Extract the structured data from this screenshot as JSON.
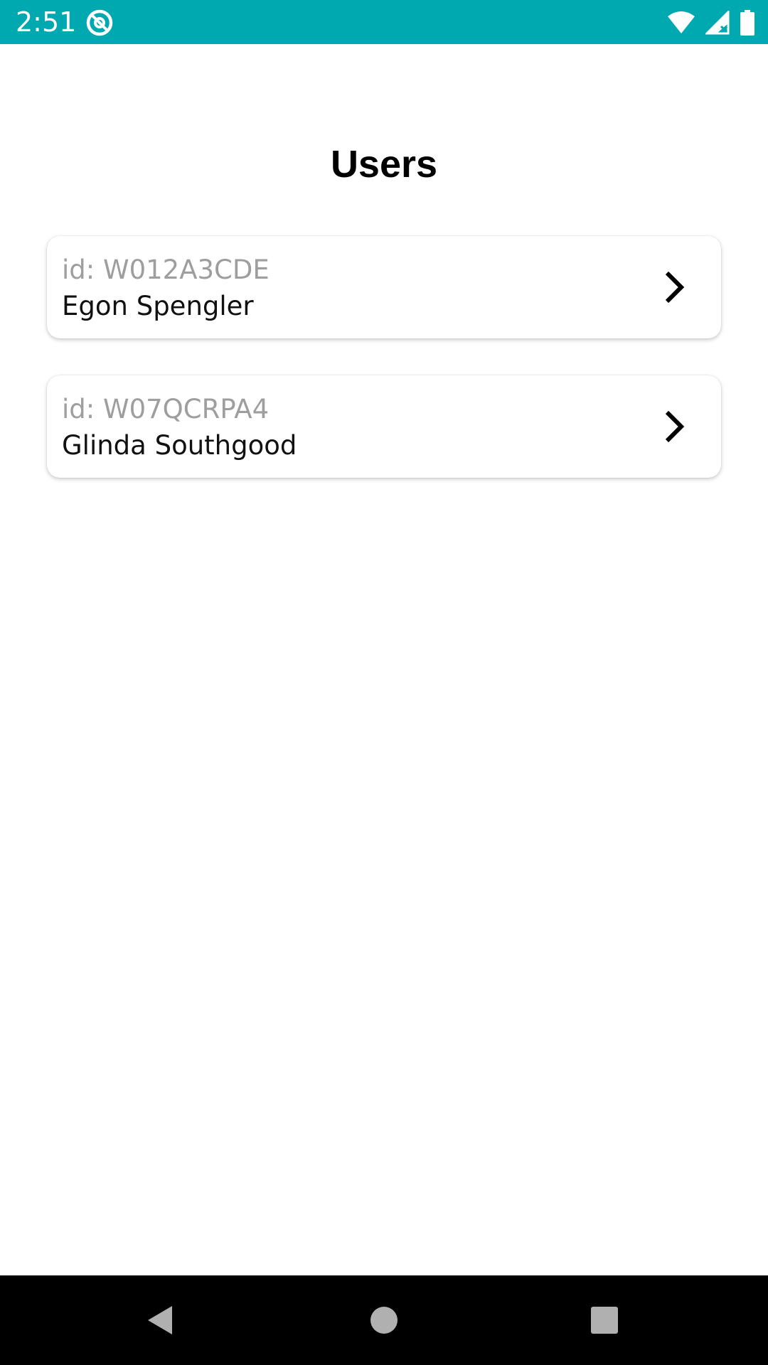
{
  "status_bar": {
    "time": "2:51",
    "background_color": "#00a8b0",
    "app_icon": "at-sign-icon",
    "icons": [
      "wifi-icon",
      "cell-signal-icon",
      "battery-icon"
    ]
  },
  "page": {
    "title": "Users"
  },
  "users": [
    {
      "id_label": "id: W012A3CDE",
      "name": "Egon Spengler"
    },
    {
      "id_label": "id: W07QCRPA4",
      "name": "Glinda Southgood"
    }
  ],
  "nav_bar": {
    "buttons": [
      "back-icon",
      "home-icon",
      "recents-icon"
    ],
    "icon_color": "#b0b0b0"
  }
}
